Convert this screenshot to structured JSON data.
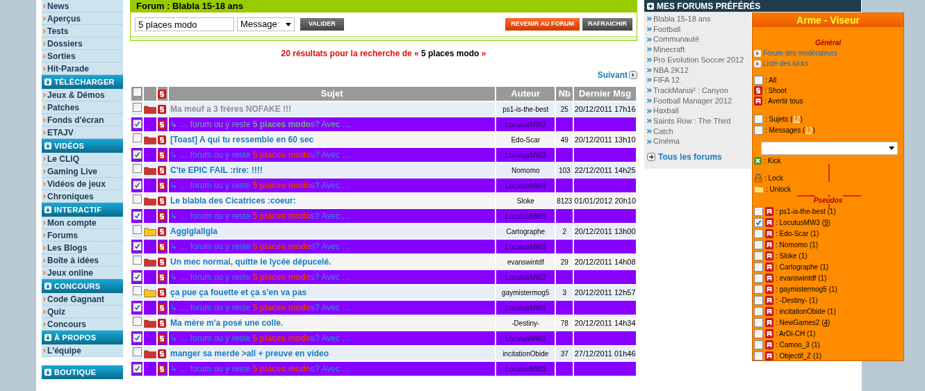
{
  "sidebar": {
    "groups": [
      {
        "items": [
          "News",
          "Aperçus",
          "Tests",
          "Dossiers",
          "Sorties",
          "Hit-Parade"
        ]
      },
      {
        "header": "TÉLÉCHARGER",
        "items": [
          "Jeux & Démos",
          "Patches",
          "Fonds d'écran",
          "ETAJV"
        ]
      },
      {
        "header": "VIDÉOS",
        "items": [
          "Le CLIQ",
          "Gaming Live",
          "Vidéos de jeux",
          "Chroniques"
        ]
      },
      {
        "header": "INTERACTIF",
        "items": [
          "Mon compte",
          "Forums",
          "Les Blogs",
          "Boîte à idées",
          "Jeux online"
        ]
      },
      {
        "header": "CONCOURS",
        "items": [
          "Code Gagnant",
          "Quiz",
          "Concours"
        ]
      },
      {
        "header": "À PROPOS",
        "items": [
          "L'équipe"
        ]
      },
      {
        "header": "BOUTIQUE"
      }
    ]
  },
  "forum": {
    "title": "Forum : Blabla 15-18 ans",
    "search": {
      "value": "5 places modo",
      "scope": "Message",
      "submit": "VALIDER"
    },
    "buttons": [
      {
        "label": "REVENIR AU FORUM",
        "kind": "primary"
      },
      {
        "label": "RAFRAICHIR",
        "kind": "secondary"
      }
    ],
    "results": {
      "prefix": "20 résultats pour la recherche de «",
      "query": "5 places modo",
      "suffix": "»"
    },
    "next": "Suivant",
    "table": {
      "columns": [
        "Sujet",
        "Auteur",
        "Nb",
        "Dernier Msg"
      ],
      "header_checked": false,
      "rows": [
        {
          "kind": "topic",
          "checked": false,
          "color": "#cc3333",
          "visited": true,
          "title": "Ma meuf a 3 frères NOFAKE !!!",
          "author": "ps1-is-the-best",
          "nb": "25",
          "last": "20/12/2011 17h16"
        },
        {
          "kind": "message",
          "checked": true,
          "visited": true,
          "title": "↳ … forum ou y reste **5 places modo**s? Avec …",
          "author": "LocutusMW3"
        },
        {
          "kind": "topic",
          "checked": false,
          "color": "#cc3333",
          "visited": false,
          "title": "[Toast] A qui tu ressemble en 60 sec",
          "author": "Edo-Scar",
          "nb": "49",
          "last": "20/12/2011 13h10"
        },
        {
          "kind": "message",
          "checked": true,
          "visited": false,
          "title": "↳ … forum ou y reste **5 places modo**s? Avec …",
          "author": "LocutusMW3"
        },
        {
          "kind": "topic",
          "checked": false,
          "color": "#cc3333",
          "visited": false,
          "title": "C'te EPIC FAIL :rire: !!!!",
          "author": "Nomomo",
          "nb": "103",
          "last": "22/12/2011 14h25"
        },
        {
          "kind": "message",
          "checked": true,
          "visited": false,
          "title": "↳ … forum ou y reste **5 places modo**s? Avec …",
          "author": "LocutusMW3"
        },
        {
          "kind": "topic",
          "checked": false,
          "color": "#cc3333",
          "visited": false,
          "title": "Le blabla des Cicatrices :coeur:",
          "author": "Sloke",
          "nb": "8123",
          "last": "01/01/2012 20h10"
        },
        {
          "kind": "message",
          "checked": true,
          "visited": false,
          "title": "↳ … forum ou y reste **5 places modo**s? Avec …",
          "author": "LocutusMW3"
        },
        {
          "kind": "topic",
          "checked": false,
          "color": "#f2c81e",
          "visited": false,
          "title": "Agglglallgla",
          "author": "Cartographe",
          "nb": "2",
          "last": "20/12/2011 13h00"
        },
        {
          "kind": "message",
          "checked": true,
          "visited": false,
          "title": "↳ … forum ou y reste **5 places modo**s? Avec …",
          "author": "LocutusMW3"
        },
        {
          "kind": "topic",
          "checked": false,
          "color": "#cc3333",
          "visited": false,
          "title": "Un mec normal, quitte le lycée dépucelé.",
          "author": "evanswintdf",
          "nb": "29",
          "last": "20/12/2011 14h08"
        },
        {
          "kind": "message",
          "checked": true,
          "visited": false,
          "title": "↳ … forum ou y reste **5 places modo**s? Avec …",
          "author": "LocutusMW3"
        },
        {
          "kind": "topic",
          "checked": false,
          "color": "#f2c81e",
          "visited": false,
          "title": "ça pue ça fouette et ça s'en va pas",
          "author": "gaymistermog5",
          "nb": "3",
          "last": "20/12/2011 12h57"
        },
        {
          "kind": "message",
          "checked": true,
          "visited": false,
          "title": "↳ … forum ou y reste **5 places modo**s? Avec …",
          "author": "LocutusMW3"
        },
        {
          "kind": "topic",
          "checked": false,
          "color": "#cc3333",
          "visited": false,
          "title": "Ma mère m'a posé une colle.",
          "author": "-Destiny-",
          "nb": "78",
          "last": "20/12/2011 14h34"
        },
        {
          "kind": "message",
          "checked": true,
          "visited": false,
          "title": "↳ … forum ou y reste **5 places modo**s? Avec …",
          "author": "LocutusMW3"
        },
        {
          "kind": "topic",
          "checked": false,
          "color": "#cc3333",
          "visited": false,
          "title": "manger sa merde >all + preuve en video",
          "author": "incitationObide",
          "nb": "37",
          "last": "27/12/2011 01h46"
        },
        {
          "kind": "message",
          "checked": true,
          "visited": false,
          "title": "↳ … forum ou y reste **5 places modo**s? Avec …",
          "author": "LocutusMW3"
        }
      ]
    }
  },
  "favorites": {
    "title": "MES FORUMS PRÉFÉRÉS",
    "items": [
      "Blabla 15-18 ans",
      "Football",
      "Communauté",
      "Minecraft",
      "Pro Evolution Soccer 2012",
      "NBA 2K12",
      "FIFA 12",
      "TrackMania² : Canyon",
      "Football Manager 2012",
      "Haxball",
      "Saints Row : The Third",
      "Catch",
      "Cinéma"
    ],
    "all": "Tous les forums"
  },
  "panel": {
    "title": "Arme - Viseur",
    "general": "Général",
    "links": [
      "Forum des modérateurs",
      "Liste des kicks"
    ],
    "actions": [
      {
        "kind": "checkbox",
        "checked": false,
        "label": ": All"
      },
      {
        "kind": "shoot",
        "label": ": Shoot"
      },
      {
        "kind": "warn",
        "label": ": Avertir tous"
      }
    ],
    "filters": [
      {
        "checked": false,
        "label": ": Sujets (",
        "count": "12",
        "close": ")"
      },
      {
        "checked": false,
        "label": ": Messages (",
        "count": "13",
        "close": ")"
      }
    ],
    "tools": [
      {
        "kind": "kick",
        "label": ": Kick"
      },
      {
        "kind": "lock",
        "label": ": Lock"
      },
      {
        "kind": "unlock",
        "label": ": Unlock"
      }
    ],
    "pseudos_title": "Pseudos",
    "pseudos": [
      {
        "checked": false,
        "label": ": ps1-is-the-best (",
        "count": "1",
        "close": ")",
        "underlined": false
      },
      {
        "checked": true,
        "label": ": LocutusMW3 (",
        "count": "9",
        "close": ")",
        "underlined": true
      },
      {
        "checked": false,
        "label": ": Edo-Scar (",
        "count": "1",
        "close": ")",
        "underlined": false
      },
      {
        "checked": false,
        "label": ": Nomomo (",
        "count": "1",
        "close": ")",
        "underlined": false
      },
      {
        "checked": false,
        "label": ": Sloke (",
        "count": "1",
        "close": ")",
        "underlined": false
      },
      {
        "checked": false,
        "label": ": Cartographe (",
        "count": "1",
        "close": ")",
        "underlined": false
      },
      {
        "checked": false,
        "label": ": evanswintdf (",
        "count": "1",
        "close": ")",
        "underlined": false
      },
      {
        "checked": false,
        "label": ": gaymistermog5 (",
        "count": "1",
        "close": ")",
        "underlined": false
      },
      {
        "checked": false,
        "label": ": -Destiny- (",
        "count": "1",
        "close": ")",
        "underlined": false
      },
      {
        "checked": false,
        "label": ": incitationObide (",
        "count": "1",
        "close": ")",
        "underlined": false
      },
      {
        "checked": false,
        "label": ": NewGames2 (",
        "count": "4",
        "close": ")",
        "underlined": true
      },
      {
        "checked": false,
        "label": ": ArDi-CH (",
        "count": "1",
        "close": ")",
        "underlined": false
      },
      {
        "checked": false,
        "label": ": Camoo_3 (",
        "count": "1",
        "close": ")",
        "underlined": false
      },
      {
        "checked": false,
        "label": ": Objectif_Z (",
        "count": "1",
        "close": ")",
        "underlined": false
      }
    ]
  }
}
